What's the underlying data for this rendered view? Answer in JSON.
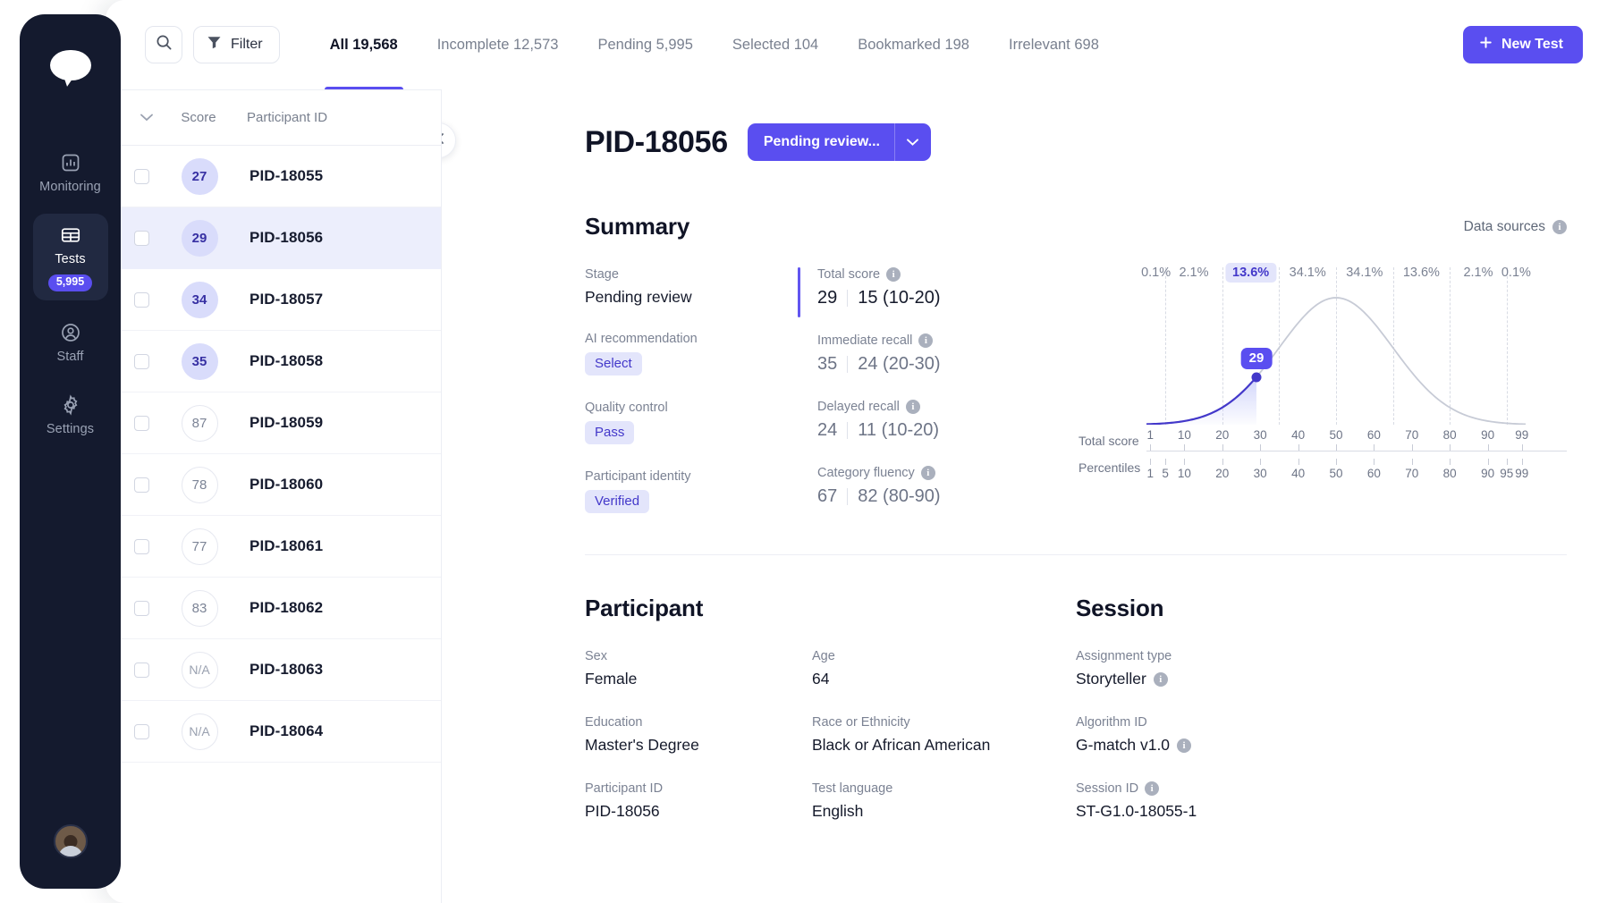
{
  "sidebar": {
    "logo_icon": "chat-bubble-logo",
    "items": [
      {
        "id": "monitoring",
        "label": "Monitoring",
        "icon": "bar-chart-icon",
        "badge": null,
        "active": false
      },
      {
        "id": "tests",
        "label": "Tests",
        "icon": "table-icon",
        "badge": "5,995",
        "active": true
      },
      {
        "id": "staff",
        "label": "Staff",
        "icon": "user-circle-icon",
        "badge": null,
        "active": false
      },
      {
        "id": "settings",
        "label": "Settings",
        "icon": "gear-icon",
        "badge": null,
        "active": false
      }
    ]
  },
  "toolbar": {
    "search_icon": "search-icon",
    "filter_label": "Filter",
    "filter_icon": "funnel-icon",
    "new_test_label": "New Test",
    "new_test_icon": "plus-icon",
    "tabs": [
      {
        "label": "All 19,568",
        "active": true
      },
      {
        "label": "Incomplete 12,573",
        "active": false
      },
      {
        "label": "Pending 5,995",
        "active": false
      },
      {
        "label": "Selected 104",
        "active": false
      },
      {
        "label": "Bookmarked 198",
        "active": false
      },
      {
        "label": "Irrelevant 698",
        "active": false
      }
    ]
  },
  "list": {
    "columns": {
      "score": "Score",
      "participant_id": "Participant ID"
    },
    "rows": [
      {
        "score": "27",
        "pid": "PID-18055",
        "style": "low",
        "selected": false
      },
      {
        "score": "29",
        "pid": "PID-18056",
        "style": "low",
        "selected": true
      },
      {
        "score": "34",
        "pid": "PID-18057",
        "style": "low",
        "selected": false
      },
      {
        "score": "35",
        "pid": "PID-18058",
        "style": "low",
        "selected": false
      },
      {
        "score": "87",
        "pid": "PID-18059",
        "style": "high",
        "selected": false
      },
      {
        "score": "78",
        "pid": "PID-18060",
        "style": "high",
        "selected": false
      },
      {
        "score": "77",
        "pid": "PID-18061",
        "style": "high",
        "selected": false
      },
      {
        "score": "83",
        "pid": "PID-18062",
        "style": "high",
        "selected": false
      },
      {
        "score": "N/A",
        "pid": "PID-18063",
        "style": "na",
        "selected": false
      },
      {
        "score": "N/A",
        "pid": "PID-18064",
        "style": "na",
        "selected": false
      }
    ]
  },
  "detail": {
    "close_icon": "close-icon",
    "title": "PID-18056",
    "status_label": "Pending review...",
    "status_caret_icon": "chevron-down-icon",
    "summary": {
      "title": "Summary",
      "data_sources_label": "Data sources",
      "data_sources_icon": "info-icon",
      "left_fields": [
        {
          "label": "Stage",
          "value": "Pending review",
          "type": "text"
        },
        {
          "label": "AI recommendation",
          "value": "Select",
          "type": "tag"
        },
        {
          "label": "Quality control",
          "value": "Pass",
          "type": "tag"
        },
        {
          "label": "Participant identity",
          "value": "Verified",
          "type": "tag"
        }
      ],
      "score_fields": [
        {
          "label": "Total score",
          "info": true,
          "primary": "29",
          "secondary": "15 (10-20)",
          "accent": true
        },
        {
          "label": "Immediate recall",
          "info": true,
          "primary": "35",
          "secondary": "24 (20-30)",
          "accent": false
        },
        {
          "label": "Delayed recall",
          "info": true,
          "primary": "24",
          "secondary": "11 (10-20)",
          "accent": false
        },
        {
          "label": "Category fluency",
          "info": true,
          "primary": "67",
          "secondary": "82 (80-90)",
          "accent": false
        }
      ]
    },
    "participant": {
      "title": "Participant",
      "fields": [
        {
          "label": "Sex",
          "value": "Female",
          "info": false
        },
        {
          "label": "Education",
          "value": "Master's Degree",
          "info": false
        },
        {
          "label": "Participant ID",
          "value": "PID-18056",
          "info": false
        },
        {
          "label": "Age",
          "value": "64",
          "info": false
        },
        {
          "label": "Race or Ethnicity",
          "value": "Black or African American",
          "info": false
        },
        {
          "label": "Test language",
          "value": "English",
          "info": false
        }
      ]
    },
    "session": {
      "title": "Session",
      "fields": [
        {
          "label": "Assignment type",
          "value": "Storyteller",
          "info": true
        },
        {
          "label": "Algorithm ID",
          "value": "G-match v1.0",
          "info": true
        },
        {
          "label": "Session ID",
          "value": "ST-G1.0-18055-1",
          "info": true,
          "label_info": true
        }
      ]
    }
  },
  "chart_data": {
    "type": "area",
    "title": "",
    "subtitle": "",
    "xlabel": "Total score",
    "ylabel": "",
    "distribution": "normal",
    "mean": 50,
    "sd": 15,
    "highlight_value": 29,
    "highlight_label": "29",
    "highlight_band_index": 2,
    "band_percentages": [
      "0.1%",
      "2.1%",
      "13.6%",
      "34.1%",
      "34.1%",
      "13.6%",
      "2.1%",
      "0.1%"
    ],
    "band_boundaries_score": [
      5,
      20,
      35,
      50,
      65,
      80,
      95
    ],
    "axes": [
      {
        "name": "Total score",
        "ticks": [
          1,
          10,
          20,
          30,
          40,
          50,
          60,
          70,
          80,
          90,
          99
        ],
        "labels": [
          "1",
          "10",
          "20",
          "30",
          "40",
          "50",
          "60",
          "70",
          "80",
          "90",
          "99"
        ]
      },
      {
        "name": "Percentiles",
        "ticks": [
          1,
          5,
          10,
          20,
          30,
          40,
          50,
          60,
          70,
          80,
          90,
          95,
          99
        ],
        "labels": [
          "1",
          "5",
          "10",
          "20",
          "30",
          "40",
          "50",
          "60",
          "70",
          "80",
          "90",
          "95",
          "99"
        ]
      }
    ],
    "xlim": [
      0,
      100
    ],
    "grid": true,
    "legend": "none",
    "colors": {
      "curve": "#c7cbd6",
      "highlight_curve": "#4338ca",
      "fill": "#c9cefa",
      "marker": "#5a4ef0"
    }
  },
  "colors": {
    "accent": "#5a4ef0",
    "accent_dark": "#4338ca",
    "sidebar_bg": "#141a2e",
    "tag_bg": "#e3e5fb",
    "selected_row": "#eceefc",
    "text": "#101426",
    "muted": "#7b8293"
  }
}
